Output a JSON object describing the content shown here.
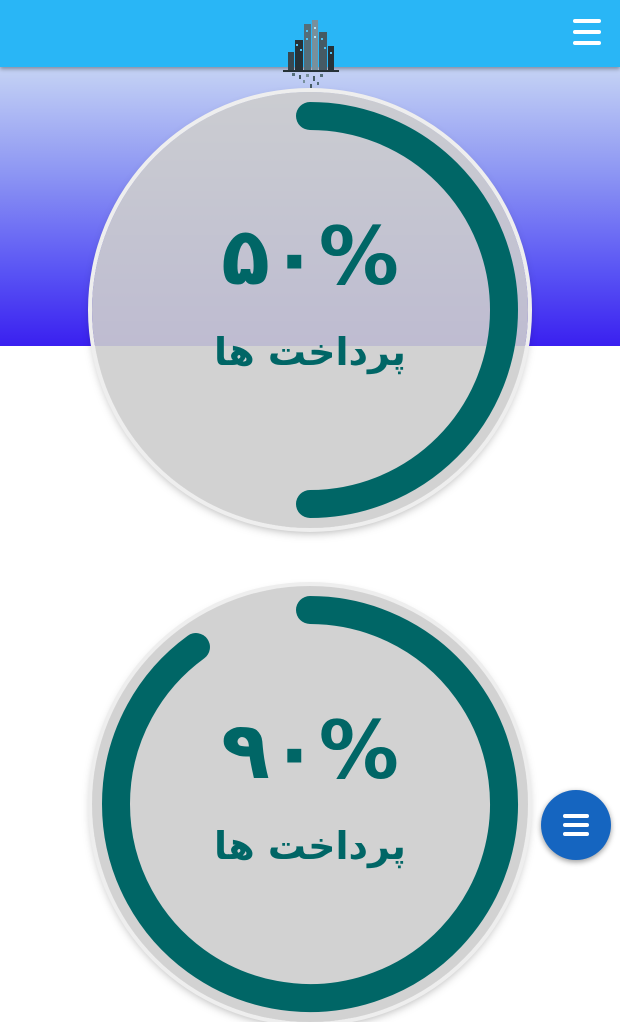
{
  "header": {
    "background_color": "#29b6f6",
    "logo_icon": "city-skyline-logo-icon",
    "menu_icon": "hamburger-menu-icon"
  },
  "hero": {
    "gradient_colors": [
      "#f2f4fb",
      "#c4d2f4",
      "#8d96f3",
      "#5a55f4",
      "#3a20f0"
    ]
  },
  "gauges": [
    {
      "value_text": "۵۰%",
      "label": "پرداخت ها",
      "progress": 0.5,
      "ring_color": "#006666"
    },
    {
      "value_text": "۹۰%",
      "label": "پرداخت ها",
      "progress": 0.9,
      "ring_color": "#006666"
    }
  ],
  "fab": {
    "icon": "menu-lines-icon",
    "color": "#1565c0"
  }
}
